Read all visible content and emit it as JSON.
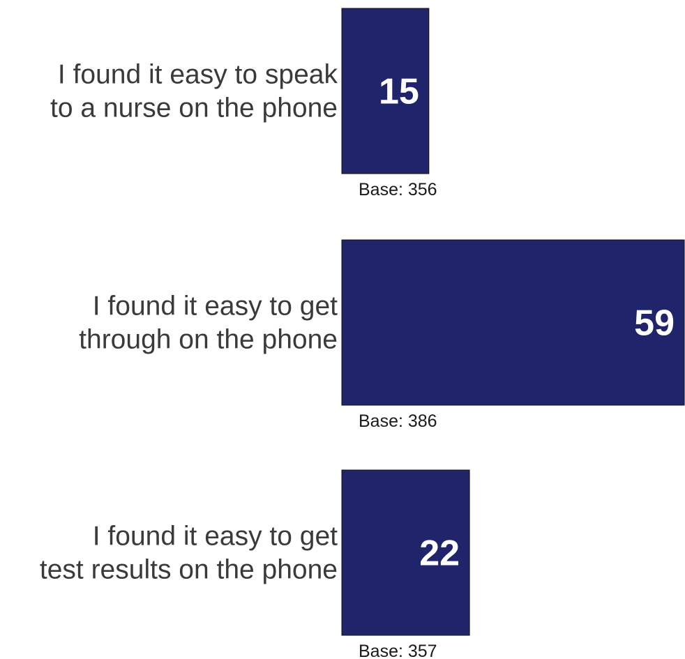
{
  "chart_data": {
    "type": "bar",
    "orientation": "horizontal",
    "categories": [
      [
        "I found it easy to speak",
        "to a nurse on the phone"
      ],
      [
        "I found it easy to get",
        "through on the phone"
      ],
      [
        "I found it easy to get",
        "test results on the phone"
      ]
    ],
    "values": [
      15,
      59,
      22
    ],
    "value_labels": [
      "15",
      "59",
      "22"
    ],
    "bases": [
      "Base: 356",
      "Base: 386",
      "Base: 357"
    ],
    "xlim": [
      0,
      59
    ],
    "bar_color": "#1f246b",
    "value_label_color": "#ffffff",
    "grid": false,
    "title": "",
    "xlabel": "",
    "ylabel": ""
  }
}
